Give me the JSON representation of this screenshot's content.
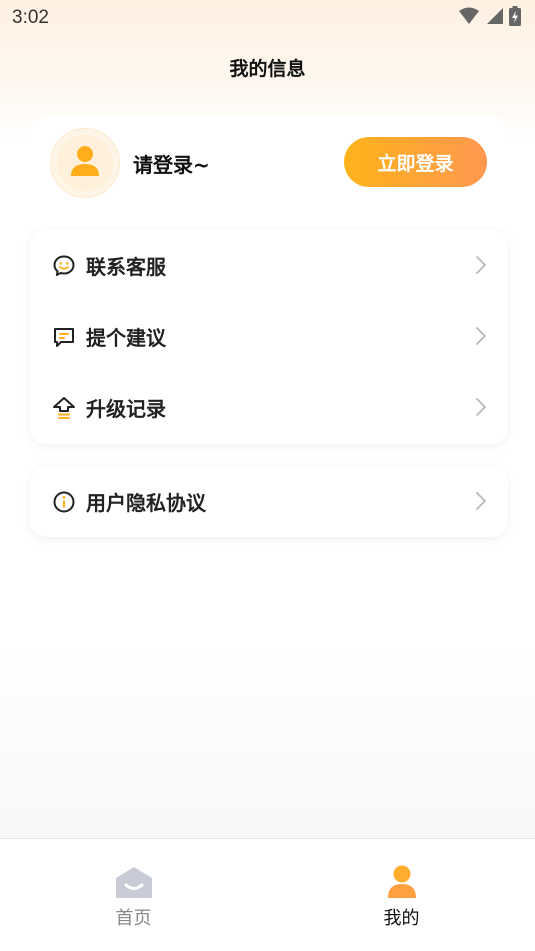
{
  "status_bar": {
    "time": "3:02",
    "icons": [
      "wifi-icon",
      "signal-icon",
      "battery-charging-icon"
    ]
  },
  "header": {
    "title": "我的信息"
  },
  "profile": {
    "avatar_icon": "user-icon",
    "login_prompt": "请登录~",
    "login_button_label": "立即登录"
  },
  "menu": {
    "group1": [
      {
        "label": "联系客服",
        "icon": "customer-service-icon"
      },
      {
        "label": "提个建议",
        "icon": "suggestion-icon"
      },
      {
        "label": "升级记录",
        "icon": "upgrade-icon"
      }
    ],
    "group2": [
      {
        "label": "用户隐私协议",
        "icon": "info-icon"
      }
    ]
  },
  "bottom_nav": {
    "tabs": [
      {
        "label": "首页",
        "icon": "home-icon",
        "active": false
      },
      {
        "label": "我的",
        "icon": "user-icon",
        "active": true
      }
    ]
  },
  "colors": {
    "accent": "#ffb21a",
    "accent_end": "#ff9850",
    "icon_dark": "#222222",
    "inactive_nav": "#c9cbd6"
  }
}
